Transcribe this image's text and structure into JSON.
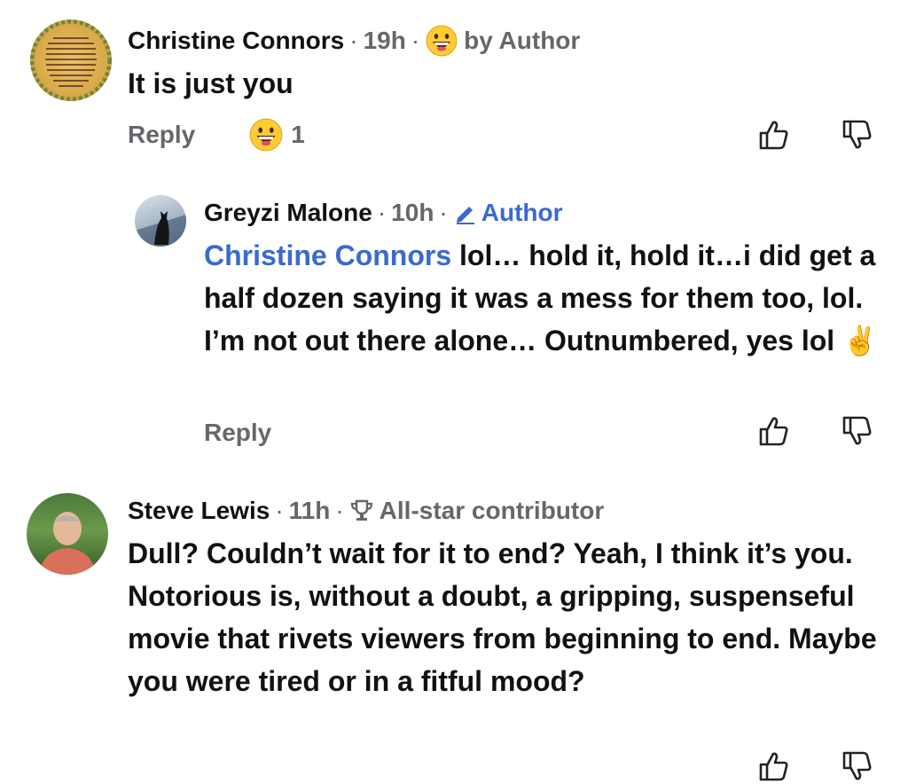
{
  "comments": [
    {
      "name": "Christine Connors",
      "time": "19h",
      "badge": "by Author",
      "badge_icon": "grinning-face-emoji",
      "text": "It is just you",
      "reply_label": "Reply",
      "reaction_count": "1",
      "reaction_icon": "grinning-face-emoji",
      "avatar_text": "I choose Inclusion. I choose Equality. Companion. Equality. Dignity. Diversity. I choose Community. Kindness. Integrity. Honesty. Respect. I choose Justice. I choose Facts. Peace. The Planet. I choose Humanity. I choose LOVE."
    },
    {
      "name": "Greyzi Malone",
      "time": "10h",
      "badge": "Author",
      "badge_icon": "pencil-icon",
      "mention": "Christine Connors",
      "text": " lol… hold it, hold it…i did get a half dozen saying it was a mess for them too, lol.  I’m not out there alone… Outnumbered, yes lol ",
      "text_emoji": "✌️",
      "reply_label": "Reply"
    },
    {
      "name": "Steve Lewis",
      "time": "11h",
      "badge": "All-star contributor",
      "badge_icon": "trophy-icon",
      "text": "Dull?  Couldn’t wait for it to end?  Yeah, I think it’s you. Notorious is, without a doubt, a gripping, suspenseful movie that rivets viewers from beginning to end. Maybe you were tired or in a fitful mood?"
    }
  ],
  "separator": "·",
  "colors": {
    "mention": "#3a6ad0",
    "meta": "#65676b",
    "text": "#111111"
  }
}
